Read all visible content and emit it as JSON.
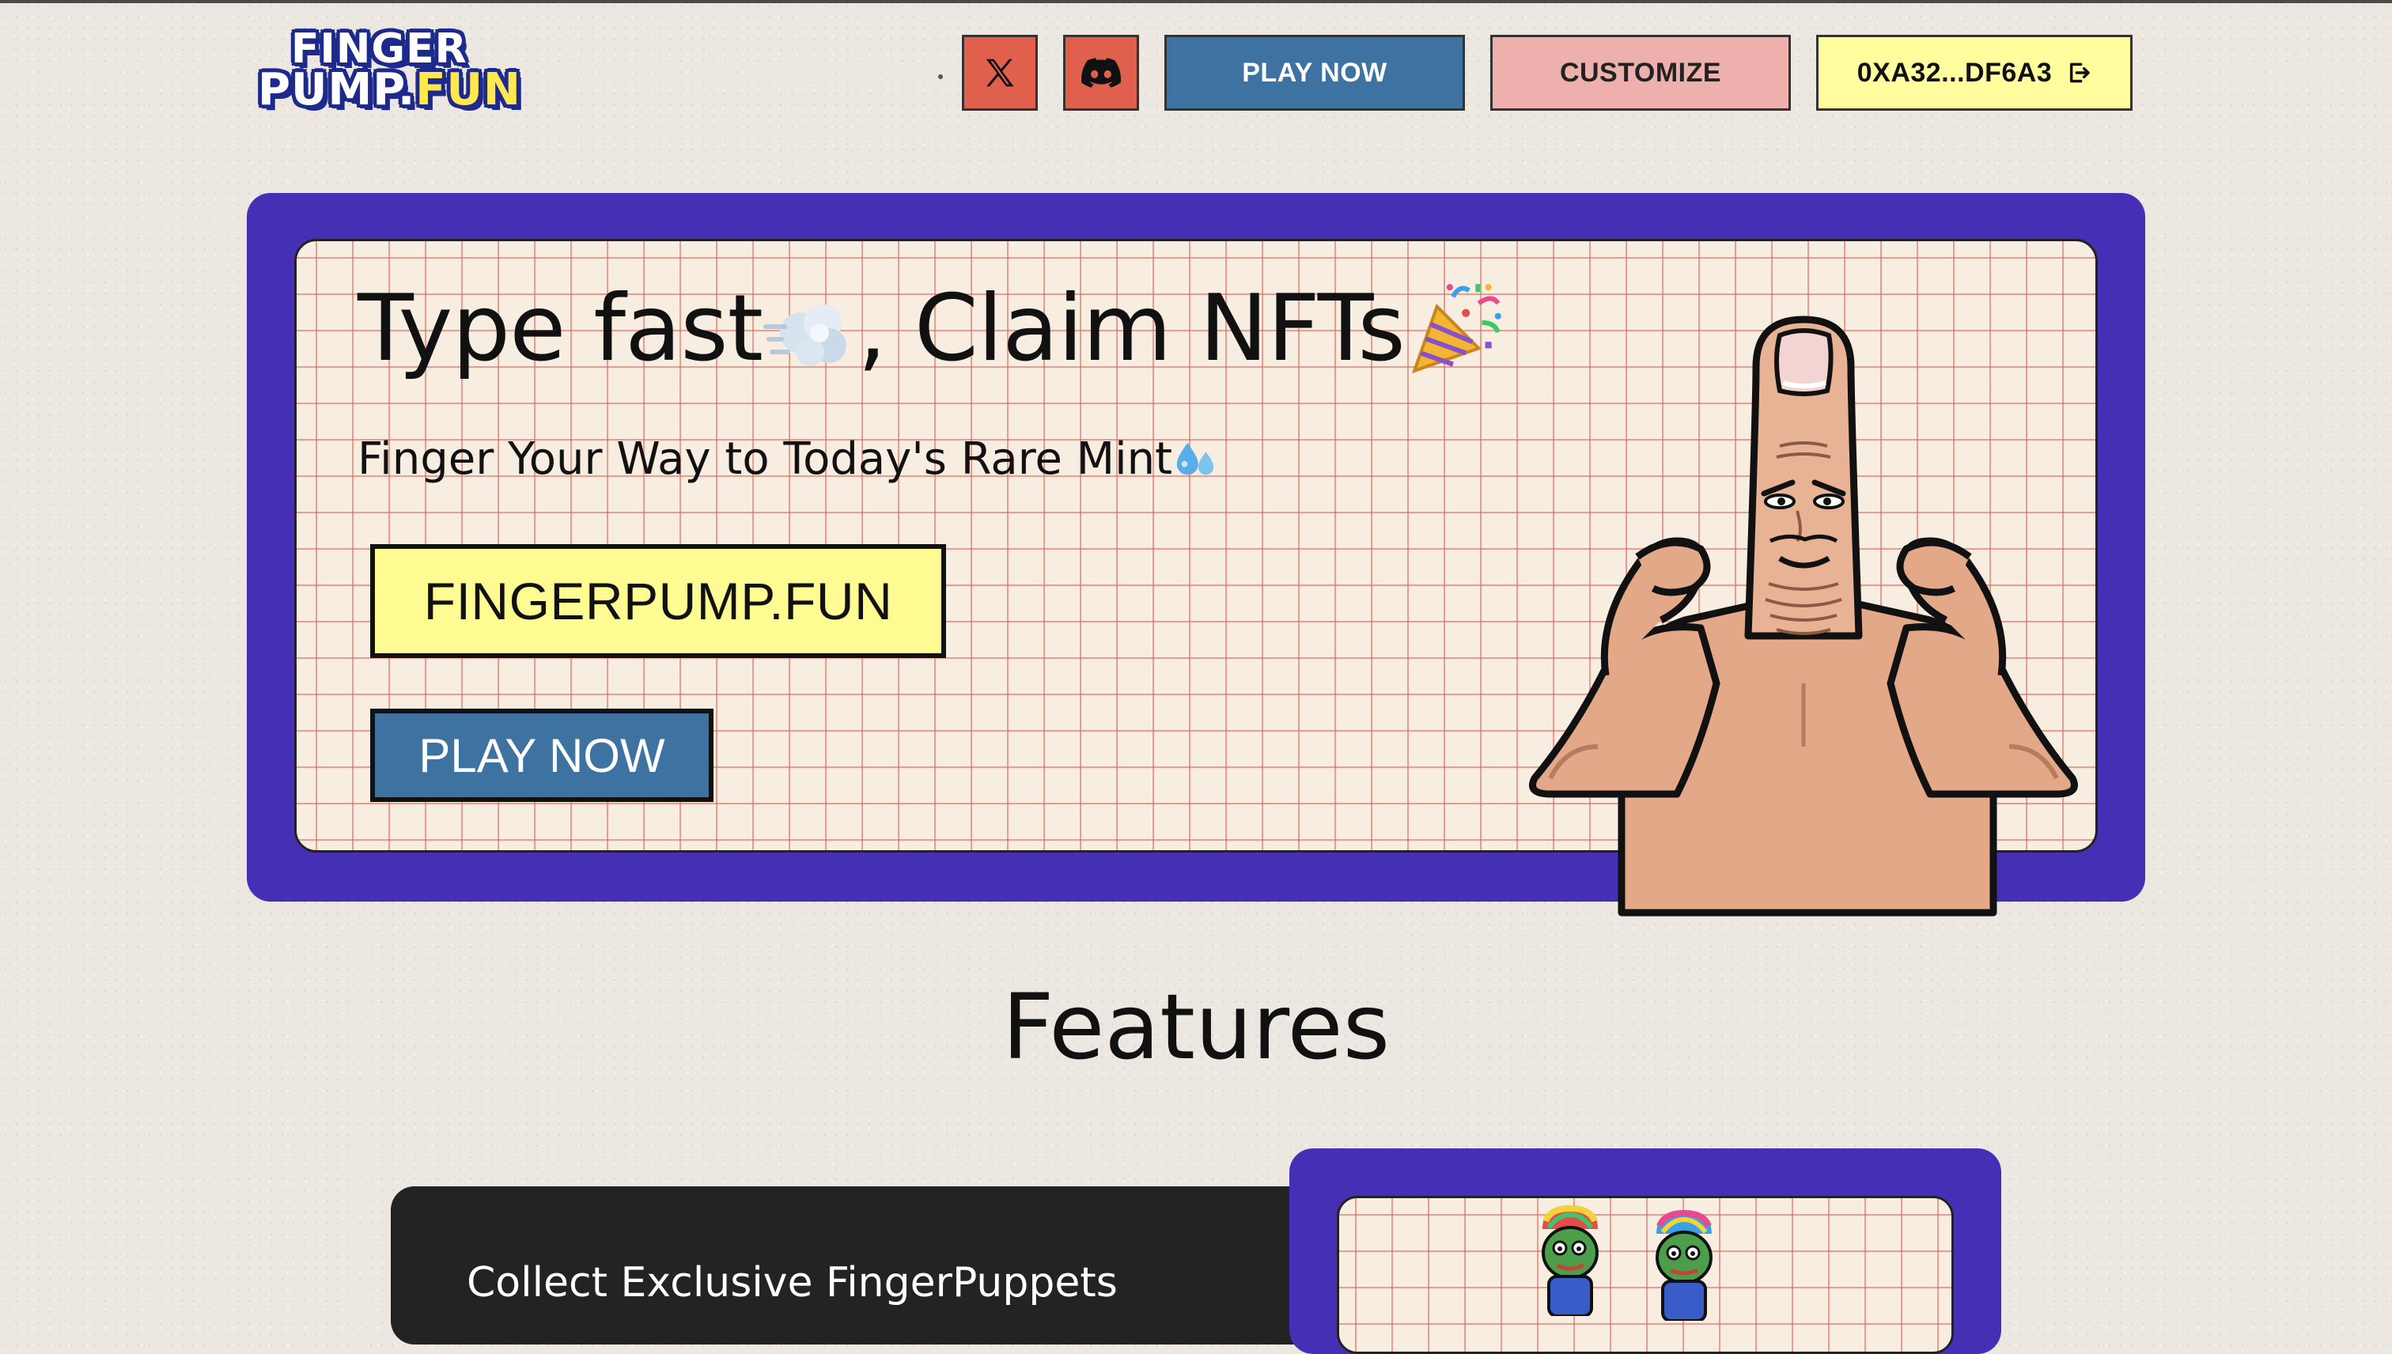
{
  "header": {
    "logo_line1": "FINGER",
    "logo_line2_a": "PUMP.",
    "logo_line2_b": "FUN",
    "social": [
      {
        "icon": "x-logo-icon"
      },
      {
        "icon": "discord-icon"
      }
    ],
    "play_label": "PLAY NOW",
    "customize_label": "CUSTOMIZE",
    "wallet_label": "0XA32...DF6A3",
    "wallet_icon": "logout-icon"
  },
  "hero": {
    "title_part1": "Type fast",
    "title_part2": ", Claim NFTs",
    "subtitle": "Finger Your Way to Today's Rare Mint",
    "domain_label": "FINGERPUMP.FUN",
    "play_label": "PLAY NOW",
    "mascot_icon": "muscle-finger-mascot"
  },
  "features": {
    "heading": "Features",
    "first_title": "Collect Exclusive FingerPuppets"
  },
  "colors": {
    "page_bg": "#ece8e1",
    "frame_purple": "#4530b5",
    "grid_paper": "#f7ede0",
    "grid_line": "#e25a50",
    "blue_button": "#3e72a1",
    "red_button": "#e0604d",
    "pink_button": "#eeb0ad",
    "yellow_button": "#fffd9e",
    "dark_card": "#232323"
  }
}
